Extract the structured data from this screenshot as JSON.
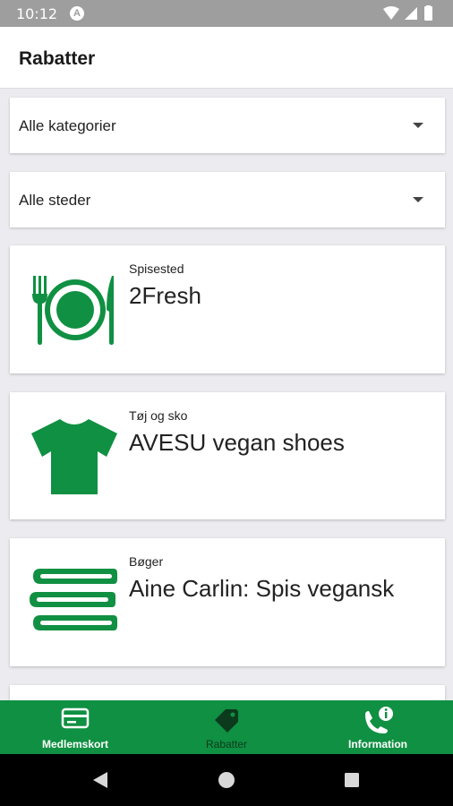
{
  "status_bar": {
    "time": "10:12",
    "badge": "A"
  },
  "app_bar": {
    "title": "Rabatter"
  },
  "filters": [
    {
      "label": "Alle kategorier"
    },
    {
      "label": "Alle steder"
    }
  ],
  "cards": [
    {
      "category": "Spisested",
      "name": "2Fresh",
      "icon": "plate-cutlery-icon"
    },
    {
      "category": "Tøj og sko",
      "name": "AVESU vegan shoes",
      "icon": "tshirt-icon"
    },
    {
      "category": "Bøger",
      "name": "Aine Carlin: Spis vegansk",
      "icon": "books-icon"
    }
  ],
  "bottom_nav": {
    "items": [
      {
        "label": "Medlemskort",
        "icon": "card-icon",
        "active": false
      },
      {
        "label": "Rabatter",
        "icon": "tag-icon",
        "active": true
      },
      {
        "label": "Information",
        "icon": "phone-info-icon",
        "active": false
      }
    ]
  },
  "colors": {
    "accent": "#109042",
    "status_bar": "#9e9e9e"
  }
}
